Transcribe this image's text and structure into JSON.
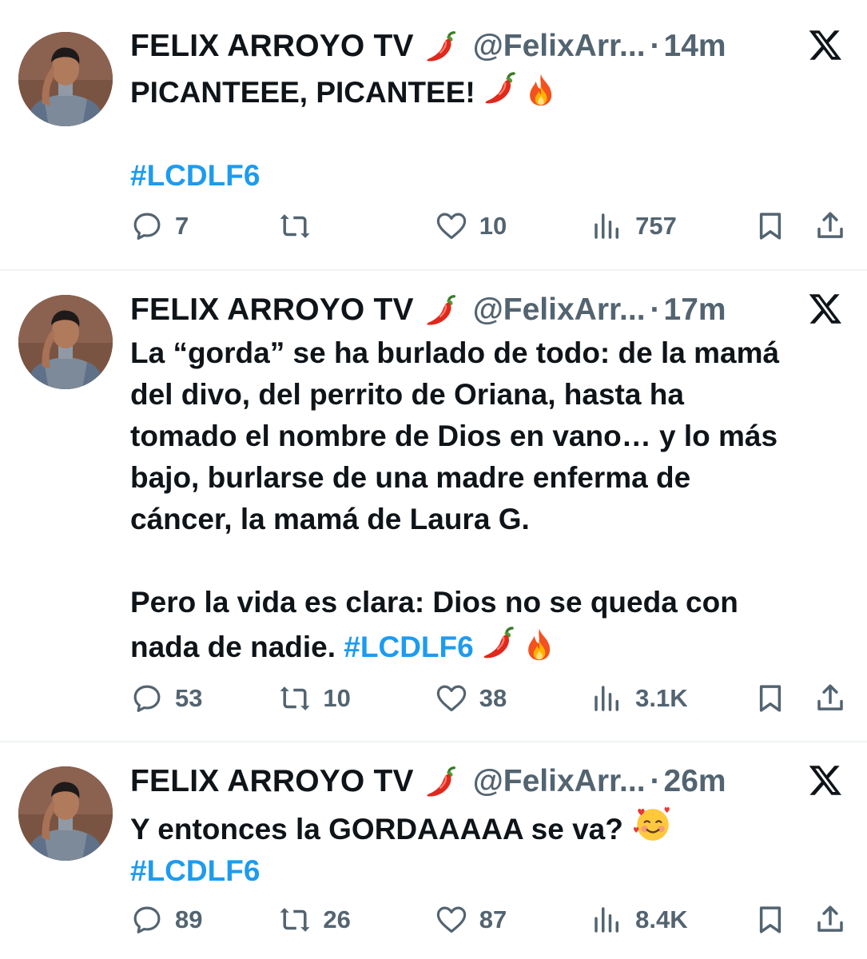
{
  "tweets": [
    {
      "author": {
        "name": "FELIX ARROYO TV",
        "handle": "@FelixArr...",
        "time": "14m",
        "name_emoji": "chili-pepper"
      },
      "text_lines": [
        {
          "text": "PICANTEEE, PICANTEE!",
          "emojis": [
            "chili-pepper",
            "fire"
          ]
        },
        {
          "text": ""
        },
        {
          "hashtag": "#LCDLF6"
        }
      ],
      "stats": {
        "replies": "7",
        "retweets": "",
        "likes": "10",
        "views": "757"
      }
    },
    {
      "author": {
        "name": "FELIX ARROYO TV",
        "handle": "@FelixArr...",
        "time": "17m",
        "name_emoji": "chili-pepper"
      },
      "text_lines": [
        {
          "text": "La “gorda” se ha burlado de todo: de la mamá"
        },
        {
          "text": "del divo, del perrito de Oriana, hasta ha"
        },
        {
          "text": "tomado el nombre de Dios en vano… y lo más"
        },
        {
          "text": "bajo, burlarse de una madre enferma de"
        },
        {
          "text": "cáncer, la mamá de Laura G."
        },
        {
          "text": ""
        },
        {
          "text": "Pero la vida es clara: Dios no se queda con"
        },
        {
          "text": "nada de nadie.",
          "hashtag": "#LCDLF6",
          "emojis": [
            "chili-pepper",
            "fire"
          ]
        }
      ],
      "stats": {
        "replies": "53",
        "retweets": "10",
        "likes": "38",
        "views": "3.1K"
      }
    },
    {
      "author": {
        "name": "FELIX ARROYO TV",
        "handle": "@FelixArr...",
        "time": "26m",
        "name_emoji": "chili-pepper"
      },
      "text_lines": [
        {
          "text": "Y entonces la GORDAAAAA se va?",
          "emojis": [
            "smiling-face-with-hearts"
          ]
        },
        {
          "hashtag": "#LCDLF6"
        }
      ],
      "stats": {
        "replies": "89",
        "retweets": "26",
        "likes": "87",
        "views": "8.4K"
      }
    }
  ],
  "ui": {
    "dot_separator": "·"
  },
  "colors": {
    "text": "#0f1419",
    "secondary": "#536471",
    "link": "#1d9bf0",
    "divider": "#eff3f4"
  },
  "icons": [
    "reply-icon",
    "retweet-icon",
    "like-icon",
    "views-icon",
    "bookmark-icon",
    "share-icon",
    "x-logo-icon"
  ]
}
